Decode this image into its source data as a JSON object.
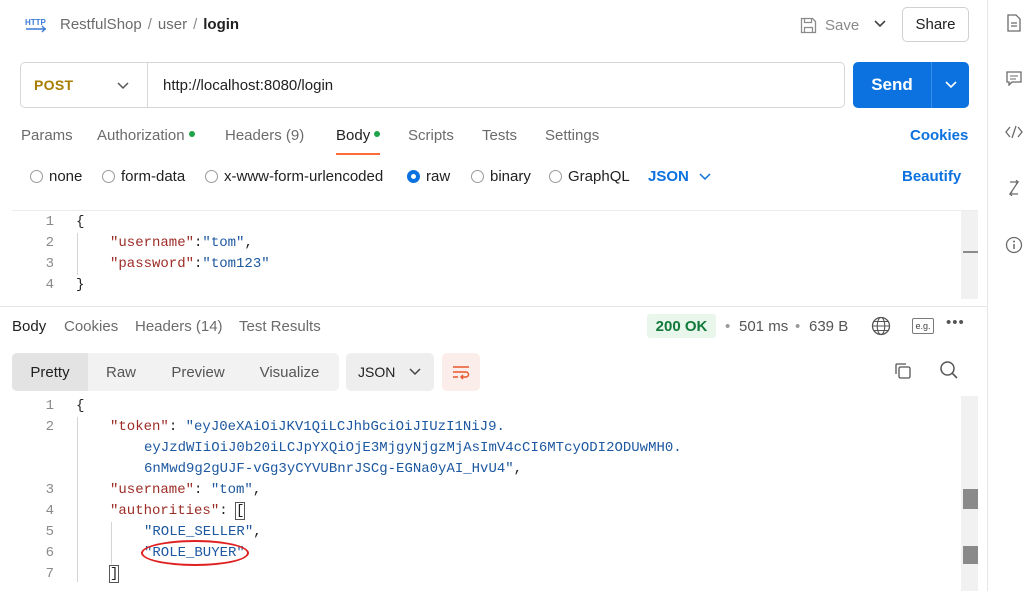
{
  "breadcrumb": {
    "badge": "HTTP",
    "workspace": "RestfulShop",
    "folder": "user",
    "request": "login"
  },
  "header": {
    "save_label": "Save",
    "share_label": "Share"
  },
  "request": {
    "method": "POST",
    "url": "http://localhost:8080/login",
    "send_label": "Send",
    "tabs": [
      {
        "label": "Params"
      },
      {
        "label": "Authorization"
      },
      {
        "label": "Headers (9)"
      },
      {
        "label": "Body"
      },
      {
        "label": "Scripts"
      },
      {
        "label": "Tests"
      },
      {
        "label": "Settings"
      }
    ],
    "cookies_label": "Cookies",
    "body_types": [
      "none",
      "form-data",
      "x-www-form-urlencoded",
      "raw",
      "binary",
      "GraphQL"
    ],
    "selected_body_type": "raw",
    "language": "JSON",
    "beautify_label": "Beautify",
    "body_lines": [
      {
        "n": "1",
        "text": "{"
      },
      {
        "n": "2",
        "key": "\"username\"",
        "sep": ":",
        "val": "\"tom\"",
        "end": ","
      },
      {
        "n": "3",
        "key": "\"password\"",
        "sep": ":",
        "val": "\"tom123\"",
        "end": ""
      },
      {
        "n": "4",
        "text": "}"
      }
    ]
  },
  "response": {
    "tabs": [
      {
        "label": "Body"
      },
      {
        "label": "Cookies"
      },
      {
        "label": "Headers (14)"
      },
      {
        "label": "Test Results"
      }
    ],
    "status": "200 OK",
    "time": "501 ms",
    "size": "639 B",
    "eg_label": "e.g.",
    "more_label": "•••",
    "views": [
      "Pretty",
      "Raw",
      "Preview",
      "Visualize"
    ],
    "format": "JSON",
    "lines": [
      {
        "n": "1",
        "text": "{"
      },
      {
        "n": "2",
        "key": "\"token\"",
        "sep": ": ",
        "val": "\"eyJ0eXAiOiJKV1QiLCJhbGciOiJIUzI1NiJ9."
      },
      {
        "n": "",
        "val": "eyJzdWIiOiJ0b20iLCJpYXQiOjE3MjgyNjgzMjAsImV4cCI6MTcyODI2ODUwMH0."
      },
      {
        "n": "",
        "val": "6nMwd9g2gUJF-vGg3yCYVUBnrJSCg-EGNa0yAI_HvU4\"",
        "end": ","
      },
      {
        "n": "3",
        "key": "\"username\"",
        "sep": ": ",
        "val": "\"tom\"",
        "end": ","
      },
      {
        "n": "4",
        "key": "\"authorities\"",
        "sep": ": ",
        "bracket": "["
      },
      {
        "n": "5",
        "val": "\"ROLE_SELLER\"",
        "end": ","
      },
      {
        "n": "6",
        "val": "\"ROLE_BUYER\""
      },
      {
        "n": "7",
        "text": "]"
      }
    ]
  }
}
